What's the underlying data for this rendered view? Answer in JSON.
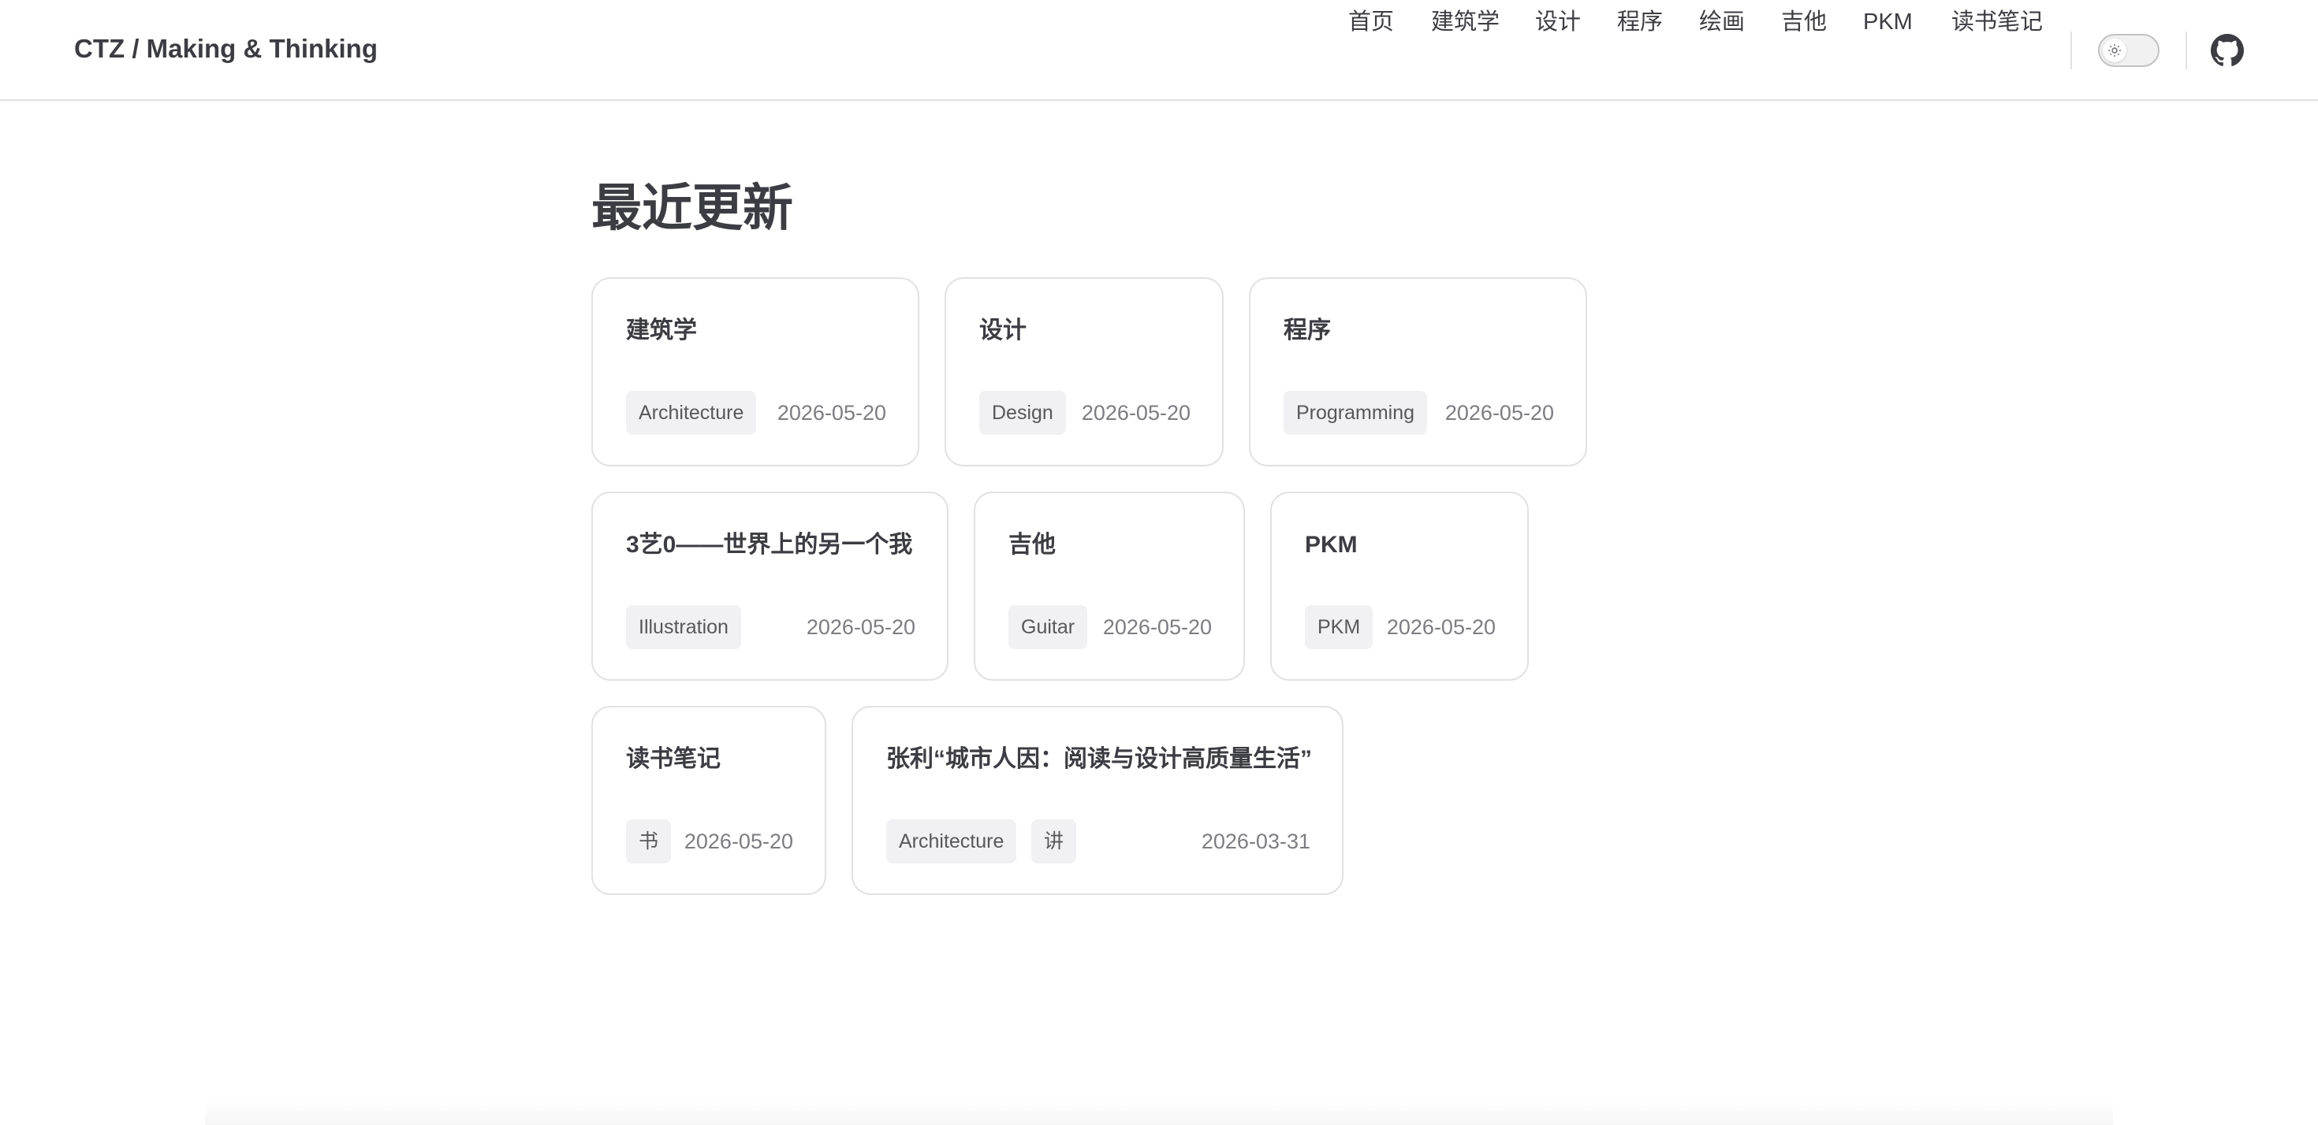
{
  "header": {
    "site_title": "CTZ / Making & Thinking",
    "nav": [
      {
        "label": "首页"
      },
      {
        "label": "建筑学"
      },
      {
        "label": "设计"
      },
      {
        "label": "程序"
      },
      {
        "label": "绘画"
      },
      {
        "label": "吉他"
      },
      {
        "label": "PKM"
      },
      {
        "label": "读书笔记"
      }
    ],
    "theme_icon": "sun-icon",
    "github_icon": "github-icon"
  },
  "main": {
    "heading": "最近更新",
    "cards": [
      {
        "title": "建筑学",
        "tags": [
          "Architecture"
        ],
        "date": "2026-05-20"
      },
      {
        "title": "设计",
        "tags": [
          "Design"
        ],
        "date": "2026-05-20"
      },
      {
        "title": "程序",
        "tags": [
          "Programming"
        ],
        "date": "2026-05-20"
      },
      {
        "title": "3艺0——世界上的另一个我",
        "tags": [
          "Illustration"
        ],
        "date": "2026-05-20"
      },
      {
        "title": "吉他",
        "tags": [
          "Guitar"
        ],
        "date": "2026-05-20"
      },
      {
        "title": "PKM",
        "tags": [
          "PKM"
        ],
        "date": "2026-05-20"
      },
      {
        "title": "读书笔记",
        "tags": [
          "书"
        ],
        "date": "2026-05-20"
      },
      {
        "title": "张利“城市人因：阅读与设计高质量生活”",
        "tags": [
          "Architecture",
          "讲"
        ],
        "date": "2026-03-31"
      }
    ]
  },
  "colors": {
    "text": "#3c3c43",
    "border": "#e2e2e3",
    "tag_bg": "#f1f1f3",
    "date": "#7c7c82"
  }
}
